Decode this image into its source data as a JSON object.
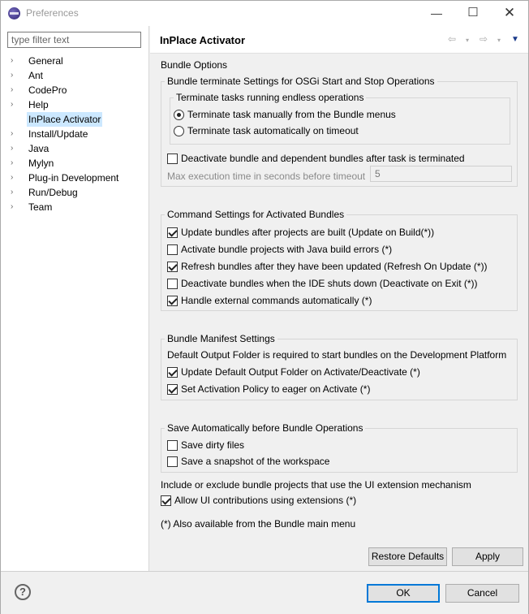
{
  "window": {
    "title": "Preferences",
    "minimize": "—",
    "maximize": "☐",
    "close": "✕"
  },
  "filter": {
    "placeholder": "type filter text",
    "value": ""
  },
  "tree": [
    {
      "label": "General",
      "arrow": "›"
    },
    {
      "label": "Ant",
      "arrow": "›"
    },
    {
      "label": "CodePro",
      "arrow": "›"
    },
    {
      "label": "Help",
      "arrow": "›"
    },
    {
      "label": "InPlace Activator",
      "arrow": ""
    },
    {
      "label": "Install/Update",
      "arrow": "›"
    },
    {
      "label": "Java",
      "arrow": "›"
    },
    {
      "label": "Mylyn",
      "arrow": "›"
    },
    {
      "label": "Plug-in Development",
      "arrow": "›"
    },
    {
      "label": "Run/Debug",
      "arrow": "›"
    },
    {
      "label": "Team",
      "arrow": "›"
    }
  ],
  "header": {
    "title": "InPlace Activator",
    "back": "⇦",
    "forward": "⇨",
    "dropdown": "▾",
    "menu": "▼"
  },
  "bundle_options": "Bundle Options",
  "terminate_group": {
    "legend": "Bundle terminate Settings for OSGi Start and Stop Operations",
    "inner_legend": "Terminate tasks running endless operations",
    "radio_manual": "Terminate task manually from the Bundle menus",
    "radio_auto": "Terminate task automatically on timeout",
    "deactivate_after": "Deactivate bundle and dependent bundles after task is terminated",
    "max_exec_label": "Max execution time in seconds before timeout",
    "max_exec_value": "5"
  },
  "command_group": {
    "legend": "Command Settings for Activated Bundles",
    "update_on_build": "Update bundles after projects are built (Update on Build(*))",
    "activate_with_errors": "Activate bundle projects with Java build errors (*)",
    "refresh_on_update": "Refresh bundles after they have been updated (Refresh On Update (*))",
    "deactivate_on_exit": "Deactivate bundles when the IDE shuts down (Deactivate on Exit (*))",
    "handle_external": "Handle external commands automatically (*)"
  },
  "manifest_group": {
    "legend": "Bundle Manifest Settings",
    "info": "Default Output Folder is required to start bundles on the Development Platform",
    "update_output": "Update Default Output Folder on Activate/Deactivate (*)",
    "activation_policy": "Set Activation Policy to eager on Activate (*)"
  },
  "save_group": {
    "legend": "Save Automatically before Bundle Operations",
    "save_dirty": "Save dirty files",
    "save_snapshot": "Save a snapshot of the workspace"
  },
  "ui_extension": {
    "label": "Include or exclude bundle projects that use the UI extension mechanism",
    "allow": "Allow UI contributions using extensions (*)"
  },
  "footnote": "(*) Also available from the Bundle main menu",
  "buttons": {
    "restore": "Restore Defaults",
    "apply": "Apply",
    "ok": "OK",
    "cancel": "Cancel",
    "help": "?"
  }
}
